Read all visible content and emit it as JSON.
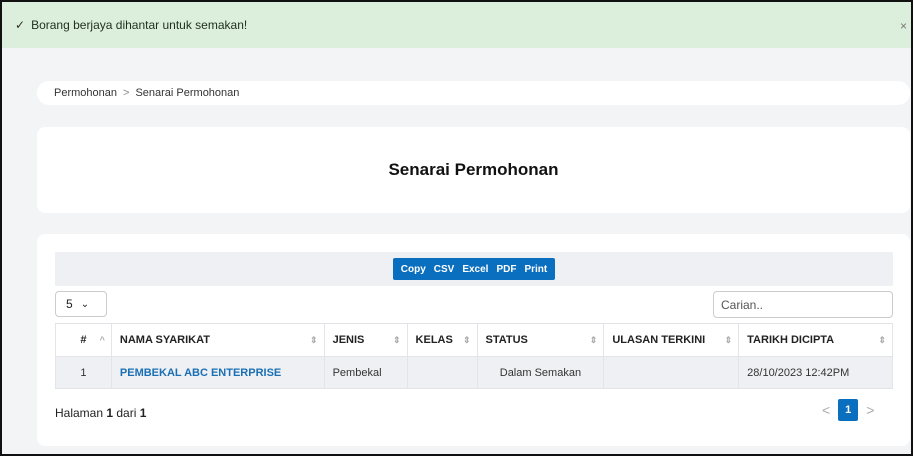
{
  "alert": {
    "message": "Borang berjaya dihantar untuk semakan!",
    "close": "×"
  },
  "breadcrumb": {
    "parent": "Permohonan",
    "separator": ">",
    "current": "Senarai Permohonan"
  },
  "page_title": "Senarai Permohonan",
  "toolbar": {
    "buttons": [
      "Copy",
      "CSV",
      "Excel",
      "PDF",
      "Print"
    ]
  },
  "length": {
    "value": "5"
  },
  "search": {
    "placeholder": "Carian.."
  },
  "table": {
    "headers": [
      "#",
      "NAMA SYARIKAT",
      "JENIS",
      "KELAS",
      "STATUS",
      "ULASAN TERKINI",
      "TARIKH DICIPTA"
    ],
    "rows": [
      [
        "1",
        "PEMBEKAL ABC ENTERPRISE",
        "Pembekal",
        "",
        "Dalam Semakan",
        "",
        "28/10/2023 12:42PM"
      ]
    ]
  },
  "footer": {
    "prefix": "Halaman",
    "page": "1",
    "middle": "dari",
    "total": "1"
  },
  "pager": {
    "prev": "<",
    "current": "1",
    "next": ">"
  },
  "colors": {
    "primary": "#0b6fbf",
    "alert_bg": "#dcefdc",
    "link": "#1a6fb5"
  }
}
